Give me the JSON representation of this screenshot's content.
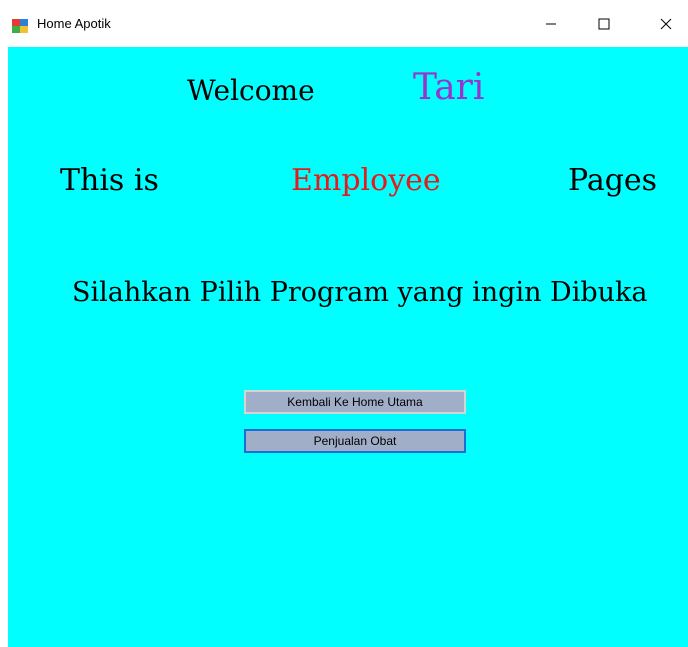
{
  "window": {
    "title": "Home Apotik",
    "icon": "app-window-icon",
    "controls": [
      "minimize-icon",
      "maximize-icon",
      "close-icon"
    ]
  },
  "content": {
    "welcome_label": "Welcome",
    "user_name": "Tari",
    "this_is_label": "This is",
    "role_label": "Employee",
    "pages_label": "Pages",
    "prompt": "Silahkan Pilih Program yang ingin Dibuka"
  },
  "buttons": {
    "home_label": "Kembali Ke Home Utama",
    "sales_label": "Penjualan Obat"
  },
  "colors": {
    "background": "#00ffff",
    "user_name": "#9933cc",
    "role": "#e41b1b",
    "button_face": "#a0aec8",
    "focused_border": "#1a6fd6"
  }
}
